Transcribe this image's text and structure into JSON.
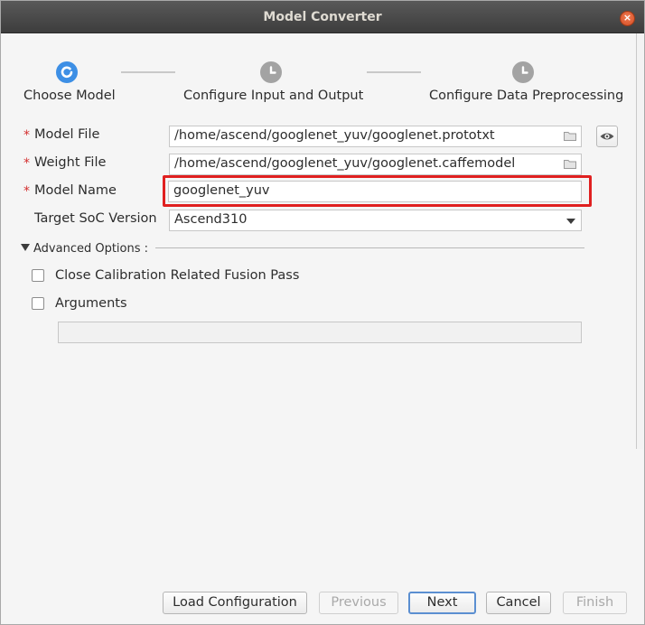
{
  "window": {
    "title": "Model Converter"
  },
  "stepper": {
    "steps": [
      {
        "label": "Choose Model",
        "state": "active"
      },
      {
        "label": "Configure Input and Output",
        "state": "pending"
      },
      {
        "label": "Configure Data Preprocessing",
        "state": "pending"
      }
    ]
  },
  "form": {
    "model_file": {
      "label": "Model File",
      "required": "*",
      "value": "/home/ascend/googlenet_yuv/googlenet.prototxt"
    },
    "weight_file": {
      "label": "Weight File",
      "required": "*",
      "value": "/home/ascend/googlenet_yuv/googlenet.caffemodel"
    },
    "model_name": {
      "label": "Model Name",
      "required": "*",
      "value": "googlenet_yuv"
    },
    "target_soc": {
      "label": "Target SoC Version",
      "value": "Ascend310"
    }
  },
  "advanced": {
    "label": "Advanced Options :",
    "options": [
      {
        "label": "Close Calibration Related Fusion Pass",
        "checked": false
      },
      {
        "label": "Arguments",
        "checked": false
      }
    ],
    "arguments_value": ""
  },
  "buttons": {
    "load_configuration": "Load Configuration",
    "previous": "Previous",
    "next": "Next",
    "cancel": "Cancel",
    "finish": "Finish"
  },
  "colors": {
    "active_step": "#3d8fe5",
    "pending_step": "#a3a3a3",
    "required_asterisk": "#d32f2f",
    "highlight_box": "#e02020"
  }
}
